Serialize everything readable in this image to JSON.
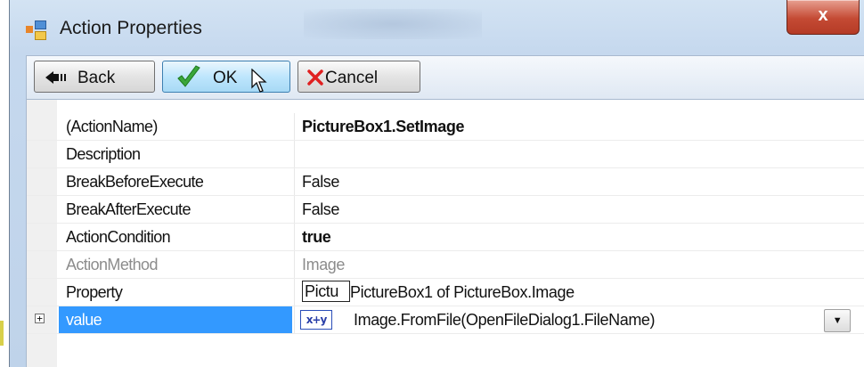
{
  "window": {
    "title": "Action Properties",
    "close_label": "x"
  },
  "toolbar": {
    "back_label": "Back",
    "ok_label": "OK",
    "cancel_label": "Cancel"
  },
  "properties": [
    {
      "name": "(ActionName)",
      "value": "PictureBox1.SetImage",
      "bold": true
    },
    {
      "name": "Description",
      "value": ""
    },
    {
      "name": "BreakBeforeExecute",
      "value": "False"
    },
    {
      "name": "BreakAfterExecute",
      "value": "False"
    },
    {
      "name": "ActionCondition",
      "value": "true",
      "bold": true
    },
    {
      "name": "ActionMethod",
      "value": "Image",
      "disabled": true
    },
    {
      "name": "Property",
      "value_box": "Pictu",
      "value": "PictureBox1 of PictureBox.Image"
    },
    {
      "name": "value",
      "icon_label": "x+y",
      "value": "Image.FromFile(OpenFileDialog1.FileName)",
      "selected": true
    }
  ],
  "icons": {
    "app": "properties-window-icon",
    "back": "back-arrow-icon",
    "ok": "green-check-icon",
    "cancel": "red-x-icon",
    "expression": "expression-icon",
    "expander": "plus-expander-icon",
    "dropdown": "dropdown-arrow-icon",
    "cursor": "mouse-pointer-icon"
  },
  "colors": {
    "selection": "#3399ff",
    "check": "#3aa63a",
    "cancel_x": "#e02020",
    "close_button": "#c44a34"
  }
}
